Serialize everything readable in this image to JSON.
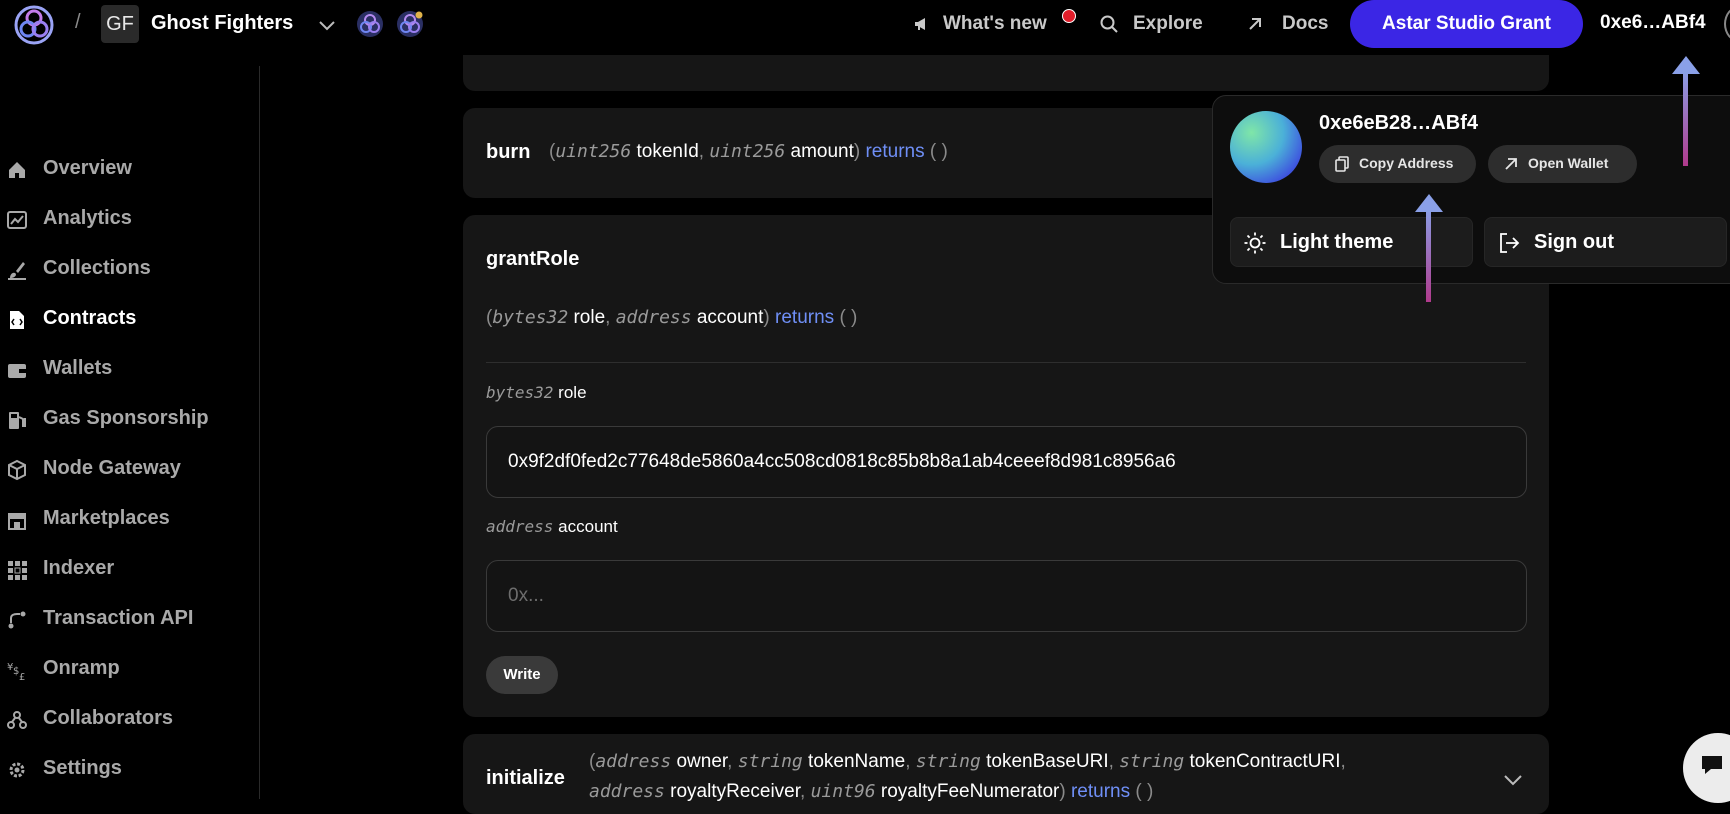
{
  "header": {
    "separator": "/",
    "project_badge": "GF",
    "project_name": "Ghost Fighters",
    "nav": {
      "whats_new": "What's new",
      "explore": "Explore",
      "docs": "Docs"
    },
    "grant_button": "Astar Studio Grant",
    "wallet_address": "0xe6…ABf4"
  },
  "sidebar": {
    "items": [
      {
        "label": "Overview",
        "icon": "home-icon"
      },
      {
        "label": "Analytics",
        "icon": "chart-icon"
      },
      {
        "label": "Collections",
        "icon": "brush-icon"
      },
      {
        "label": "Contracts",
        "icon": "file-code-icon",
        "active": true
      },
      {
        "label": "Wallets",
        "icon": "wallet-icon"
      },
      {
        "label": "Gas Sponsorship",
        "icon": "fuel-icon"
      },
      {
        "label": "Node Gateway",
        "icon": "cube-icon"
      },
      {
        "label": "Marketplaces",
        "icon": "store-icon"
      },
      {
        "label": "Indexer",
        "icon": "grid-icon"
      },
      {
        "label": "Transaction API",
        "icon": "route-icon"
      },
      {
        "label": "Onramp",
        "icon": "currency-icon"
      },
      {
        "label": "Collaborators",
        "icon": "people-icon"
      },
      {
        "label": "Settings",
        "icon": "gear-icon"
      }
    ]
  },
  "functions": {
    "burn": {
      "name": "burn",
      "p1_type": "uint256",
      "p1_name": "tokenId",
      "p2_type": "uint256",
      "p2_name": "amount",
      "returns": "returns"
    },
    "grantRole": {
      "name": "grantRole",
      "p1_type": "bytes32",
      "p1_name": "role",
      "p2_type": "address",
      "p2_name": "account",
      "returns": "returns",
      "role_value": "0x9f2df0fed2c77648de5860a4cc508cd0818c85b8b8a1ab4ceeef8d981c8956a6",
      "account_placeholder": "0x...",
      "write_label": "Write"
    },
    "initialize": {
      "name": "initialize",
      "p1_type": "address",
      "p1_name": "owner",
      "p2_type": "string",
      "p2_name": "tokenName",
      "p3_type": "string",
      "p3_name": "tokenBaseURI",
      "p4_type": "string",
      "p4_name": "tokenContractURI",
      "p5_type": "address",
      "p5_name": "royaltyReceiver",
      "p6_type": "uint96",
      "p6_name": "royaltyFeeNumerator",
      "returns": "returns"
    }
  },
  "account_menu": {
    "address": "0xe6eB28…ABf4",
    "copy_address": "Copy Address",
    "open_wallet": "Open Wallet",
    "light_theme": "Light theme",
    "sign_out": "Sign out"
  },
  "colors": {
    "accent": "#3b26e5",
    "returns_link": "#6f8ff6",
    "notification": "#e11d2a",
    "arrow_top": "#8aa0e8",
    "arrow_bottom": "#b03a8c"
  }
}
